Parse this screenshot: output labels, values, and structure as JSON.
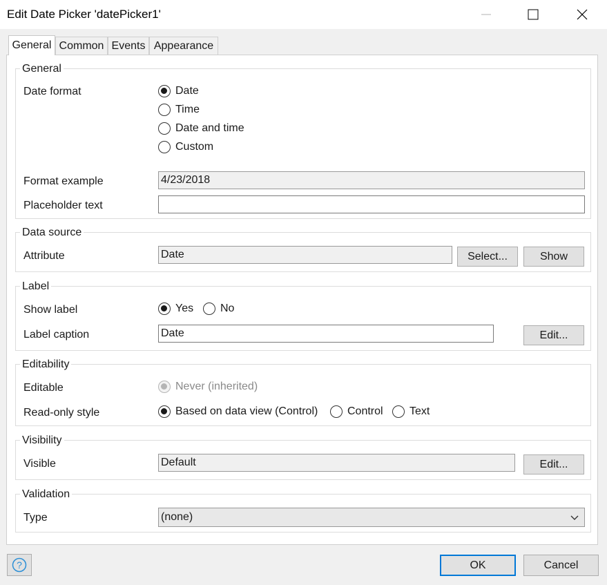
{
  "window": {
    "title": "Edit Date Picker 'datePicker1'",
    "controls": [
      "minimize-icon",
      "maximize-icon",
      "close-icon"
    ]
  },
  "tabs": [
    {
      "label": "General",
      "active": true
    },
    {
      "label": "Common",
      "active": false
    },
    {
      "label": "Events",
      "active": false
    },
    {
      "label": "Appearance",
      "active": false
    }
  ],
  "general_group": {
    "title": "General",
    "date_format_label": "Date format",
    "date_format_options": [
      "Date",
      "Time",
      "Date and time",
      "Custom"
    ],
    "date_format_selected": "Date",
    "format_example_label": "Format example",
    "format_example_value": "4/23/2018",
    "placeholder_label": "Placeholder text",
    "placeholder_value": ""
  },
  "data_source_group": {
    "title": "Data source",
    "attribute_label": "Attribute",
    "attribute_value": "Date",
    "select_button": "Select...",
    "show_button": "Show"
  },
  "label_group": {
    "title": "Label",
    "show_label_label": "Show label",
    "show_label_options": [
      "Yes",
      "No"
    ],
    "show_label_selected": "Yes",
    "caption_label": "Label caption",
    "caption_value": "Date",
    "edit_button": "Edit..."
  },
  "editability_group": {
    "title": "Editability",
    "editable_label": "Editable",
    "editable_value": "Never (inherited)",
    "readonly_label": "Read-only style",
    "readonly_options": [
      "Based on data view (Control)",
      "Control",
      "Text"
    ],
    "readonly_selected": "Based on data view (Control)"
  },
  "visibility_group": {
    "title": "Visibility",
    "visible_label": "Visible",
    "visible_value": "Default",
    "edit_button": "Edit..."
  },
  "validation_group": {
    "title": "Validation",
    "type_label": "Type",
    "type_value": "(none)"
  },
  "footer": {
    "help_icon": "help-icon",
    "ok_button": "OK",
    "cancel_button": "Cancel"
  },
  "colors": {
    "accent": "#0078d7",
    "help_icon": "#2b8fd6"
  }
}
